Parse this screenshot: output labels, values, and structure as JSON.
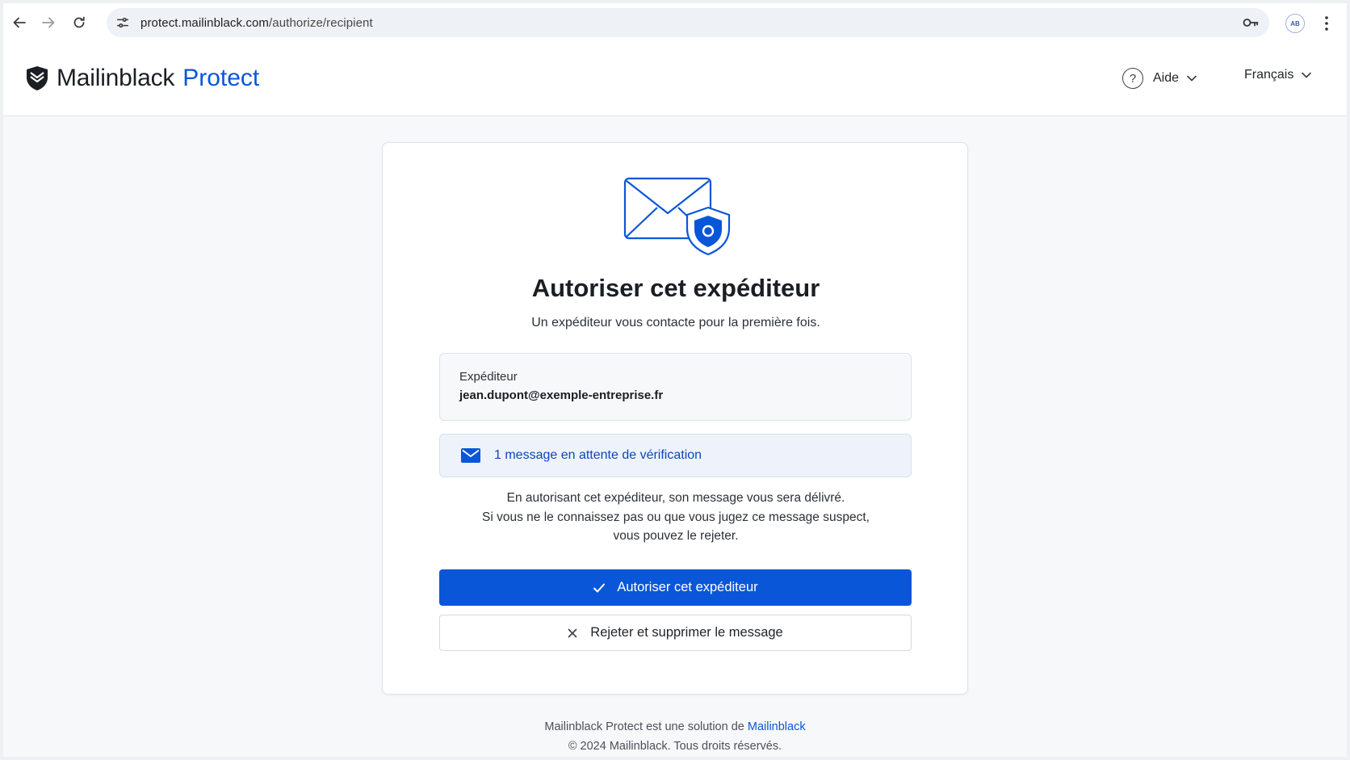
{
  "browser": {
    "url_domain": "protect.mailinblack.com",
    "url_path": "/authorize/recipient",
    "profile_initials": "AB"
  },
  "header": {
    "brand": "Mailinblack",
    "brand_accent": "Protect",
    "help_label": "Aide",
    "language_label": "Français"
  },
  "card": {
    "title": "Autoriser cet expéditeur",
    "subtitle": "Un expéditeur vous contacte pour la première fois.",
    "sender_label": "Expéditeur",
    "sender_email": "jean.dupont@exemple-entreprise.fr",
    "pending_text": "1 message en attente de vérification",
    "explain_line1": "En autorisant cet expéditeur, son message vous sera délivré.",
    "explain_line2": "Si vous ne le connaissez pas ou que vous jugez ce message suspect,",
    "explain_line3": "vous pouvez le rejeter.",
    "authorize_label": "Autoriser cet expéditeur",
    "reject_label": "Rejeter et supprimer le message"
  },
  "footer": {
    "line1_prefix": "Mailinblack Protect est une solution de ",
    "line1_link": "Mailinblack",
    "line2": "© 2024 Mailinblack. Tous droits réservés."
  },
  "colors": {
    "accent": "#0a56d8",
    "page_background": "#f7f8fa",
    "pending_background": "#eef3fb"
  },
  "icons": [
    "back-arrow-icon",
    "forward-arrow-icon",
    "reload-icon",
    "site-settings-icon",
    "password-key-icon",
    "kebab-menu-icon",
    "shield-logo-icon",
    "help-icon",
    "chevron-down-icon",
    "envelope-shield-icon",
    "envelope-icon",
    "check-icon",
    "close-icon"
  ]
}
